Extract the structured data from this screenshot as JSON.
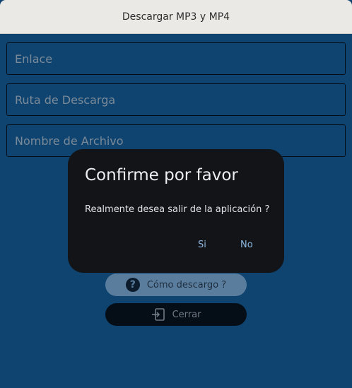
{
  "window": {
    "title": "Descargar MP3 y MP4"
  },
  "form": {
    "link_placeholder": "Enlace",
    "path_placeholder": "Ruta de Descarga",
    "filename_placeholder": "Nombre de Archivo"
  },
  "buttons": {
    "help_label": "Cómo descargo ?",
    "close_label": "Cerrar"
  },
  "dialog": {
    "title": "Confirme por favor",
    "message": "Realmente desea salir de la aplicación ?",
    "yes_label": "Si",
    "no_label": "No"
  },
  "icons": {
    "help": "question-circle-icon",
    "close": "exit-icon"
  },
  "colors": {
    "background": "#0f4470",
    "dialog_bg": "#121417",
    "accent": "#8fb8e0"
  }
}
